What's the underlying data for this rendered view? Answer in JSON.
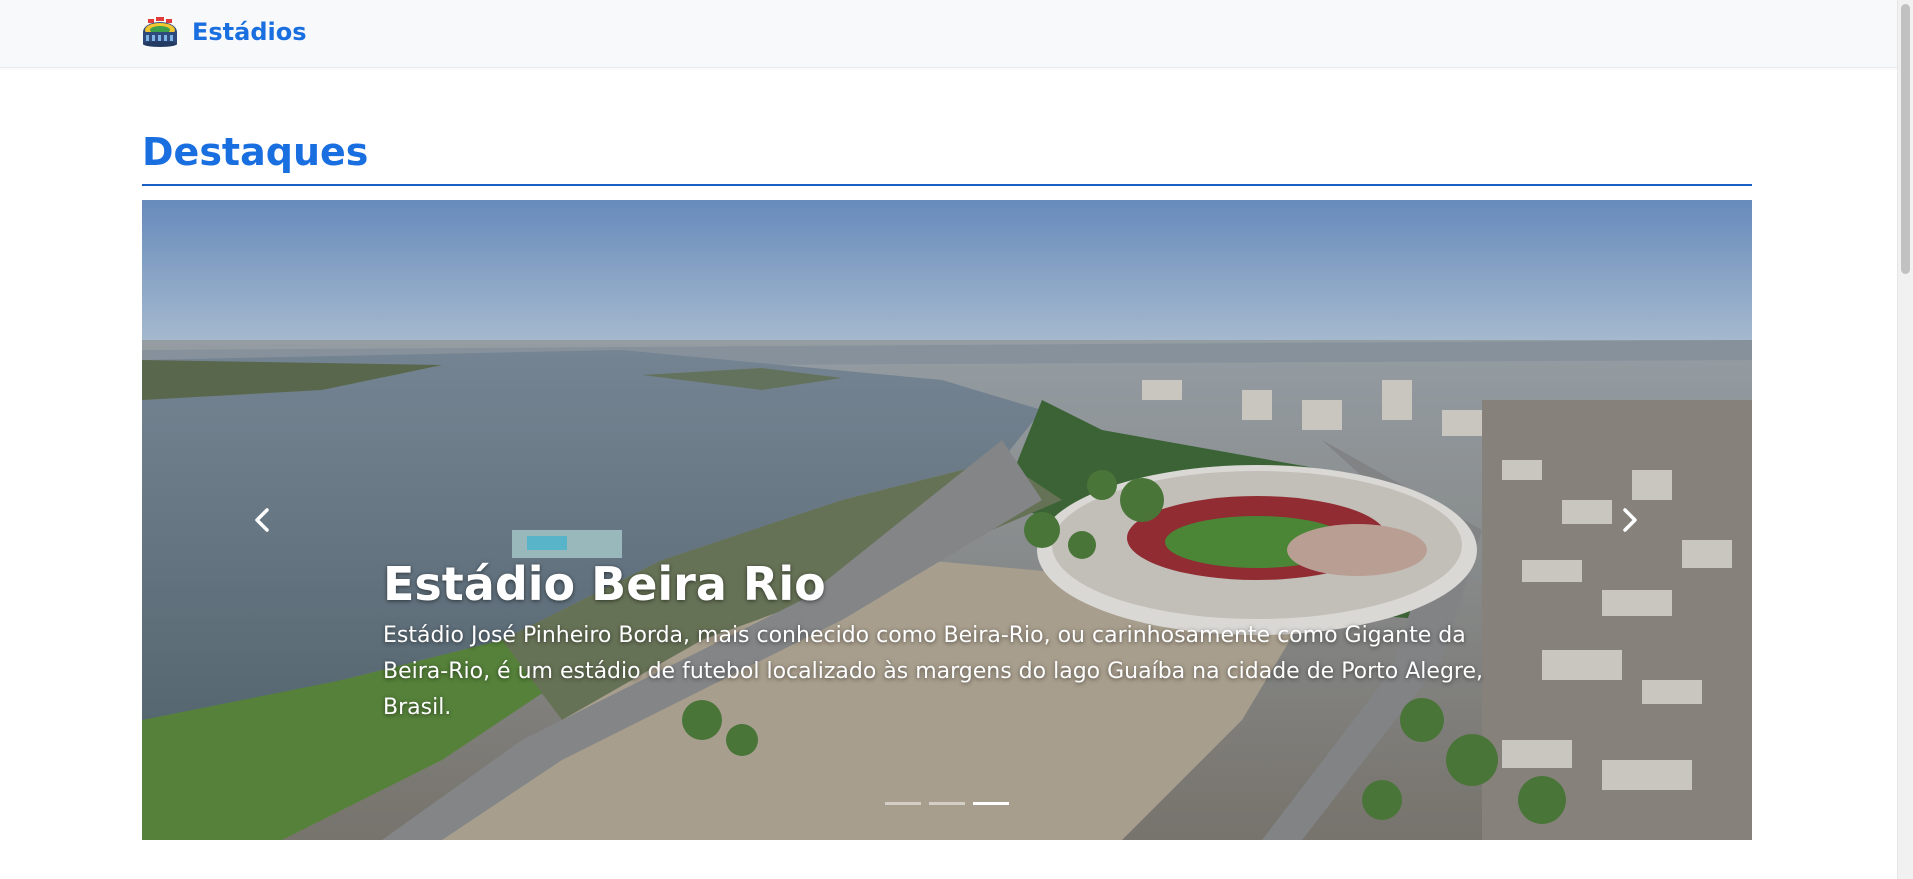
{
  "navbar": {
    "brand_name": "Estádios",
    "logo_icon": "stadium-icon"
  },
  "highlights": {
    "section_title": "Destaques",
    "carousel": {
      "active_index": 2,
      "slide_count": 3,
      "active_slide": {
        "title": "Estádio Beira Rio",
        "description": "Estádio José Pinheiro Borda, mais conhecido como Beira-Rio, ou carinhosamente como Gigante da Beira-Rio, é um estádio de futebol localizado às margens do lago Guaíba na cidade de Porto Alegre, Brasil.",
        "image": "aerial-stadium-photo"
      },
      "prev_icon": "chevron-left-icon",
      "next_icon": "chevron-right-icon"
    }
  },
  "colors": {
    "brand": "#1a6fe0",
    "rule": "#1a5fc4",
    "navbar_bg": "#f8f9fa"
  }
}
